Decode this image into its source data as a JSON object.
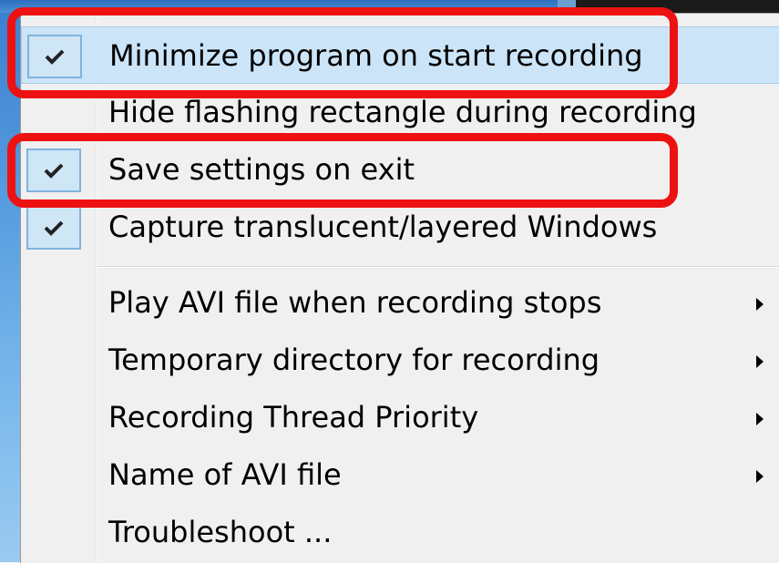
{
  "menu": {
    "items": [
      {
        "label": "Minimize program on start recording",
        "checked": true,
        "submenu": false,
        "highlighted": true
      },
      {
        "label": "Hide flashing rectangle during recording",
        "checked": false,
        "submenu": false,
        "highlighted": false
      },
      {
        "label": "Save settings on exit",
        "checked": true,
        "submenu": false,
        "highlighted": false
      },
      {
        "label": "Capture translucent/layered Windows",
        "checked": true,
        "submenu": false,
        "highlighted": false
      },
      {
        "label": "Play AVI file when recording stops",
        "checked": false,
        "submenu": true,
        "highlighted": false
      },
      {
        "label": "Temporary directory for recording",
        "checked": false,
        "submenu": true,
        "highlighted": false
      },
      {
        "label": "Recording Thread Priority",
        "checked": false,
        "submenu": true,
        "highlighted": false
      },
      {
        "label": "Name of AVI file",
        "checked": false,
        "submenu": true,
        "highlighted": false
      },
      {
        "label": "Troubleshoot ...",
        "checked": false,
        "submenu": false,
        "highlighted": false
      }
    ]
  },
  "colors": {
    "highlight": "#cce4f7",
    "annotation": "#ee1111",
    "check_box": "#cfe6f7"
  },
  "icons": {
    "check": "checkmark-icon",
    "submenu": "submenu-arrow-icon"
  }
}
